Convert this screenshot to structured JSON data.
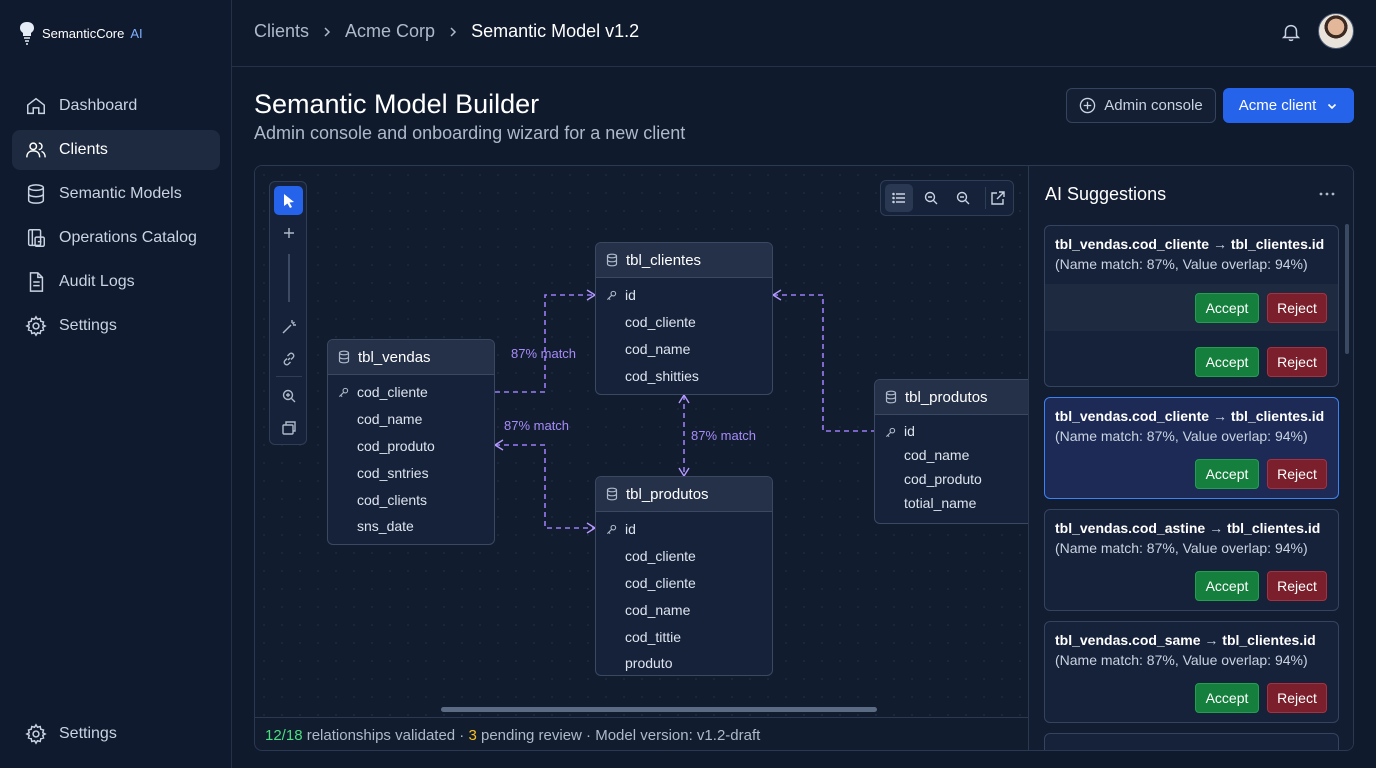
{
  "brand": {
    "name": "SemanticCore",
    "accent": "AI"
  },
  "nav": {
    "items": [
      {
        "label": "Dashboard",
        "icon": "home-icon"
      },
      {
        "label": "Clients",
        "icon": "users-icon",
        "active": true
      },
      {
        "label": "Semantic Models",
        "icon": "database-icon"
      },
      {
        "label": "Operations Catalog",
        "icon": "catalog-icon"
      },
      {
        "label": "Audit Logs",
        "icon": "document-icon"
      },
      {
        "label": "Settings",
        "icon": "gear-icon"
      }
    ],
    "bottom": {
      "label": "Settings",
      "icon": "gear-icon"
    }
  },
  "breadcrumb": [
    "Clients",
    "Acme Corp",
    "Semantic Model v1.2"
  ],
  "header": {
    "title": "Semantic Model Builder",
    "subtitle": "Admin console and onboarding wizard for a new client",
    "admin_button": "Admin console",
    "client_button": "Acme client"
  },
  "canvas": {
    "match_labels": [
      "87% match",
      "87% match",
      "87% match"
    ],
    "tables": {
      "vendas": {
        "name": "tbl_vendas",
        "fields": [
          "cod_cliente",
          "cod_name",
          "cod_produto",
          "cod_sntries",
          "cod_clients",
          "sns_date"
        ]
      },
      "clientes": {
        "name": "tbl_clientes",
        "fields": [
          "id",
          "cod_cliente",
          "cod_name",
          "cod_shitties"
        ]
      },
      "produtos_center": {
        "name": "tbl_produtos",
        "fields": [
          "id",
          "cod_cliente",
          "cod_cliente",
          "cod_name",
          "cod_tittie",
          "produto"
        ]
      },
      "produtos_right": {
        "name": "tbl_produtos",
        "fields": [
          "id",
          "cod_name",
          "cod_produto",
          "totial_name"
        ]
      }
    }
  },
  "status": {
    "validated": "12/18",
    "validated_text": " relationships validated · ",
    "pending": "3",
    "pending_text": " pending review · Model version: v1.2-draft"
  },
  "suggestions": {
    "title": "AI Suggestions",
    "accept_label": "Accept",
    "reject_label": "Reject",
    "items": [
      {
        "source": "tbl_vendas.cod_cliente",
        "target": "tbl_clientes.id",
        "detail": "(Name match: 87%, Value overlap: 94%)"
      },
      {
        "source": "tbl_vendas.cod_cliente",
        "target": "tbl_clientes.id",
        "detail": "(Name match: 87%, Value overlap: 94%)",
        "selected": true
      },
      {
        "source": "tbl_vendas.cod_astine",
        "target": "tbl_clientes.id",
        "detail": "(Name match: 87%, Value overlap: 94%)"
      },
      {
        "source": "tbl_vendas.cod_same",
        "target": "tbl_clientes.id",
        "detail": "(Name match: 87%, Value overlap: 94%)"
      }
    ]
  },
  "colors": {
    "accent": "#2563eb",
    "relationship": "#a78bfa",
    "accept": "#15803d",
    "reject": "#7a1f2b",
    "ok": "#4ade80",
    "pending": "#fbbf24"
  }
}
